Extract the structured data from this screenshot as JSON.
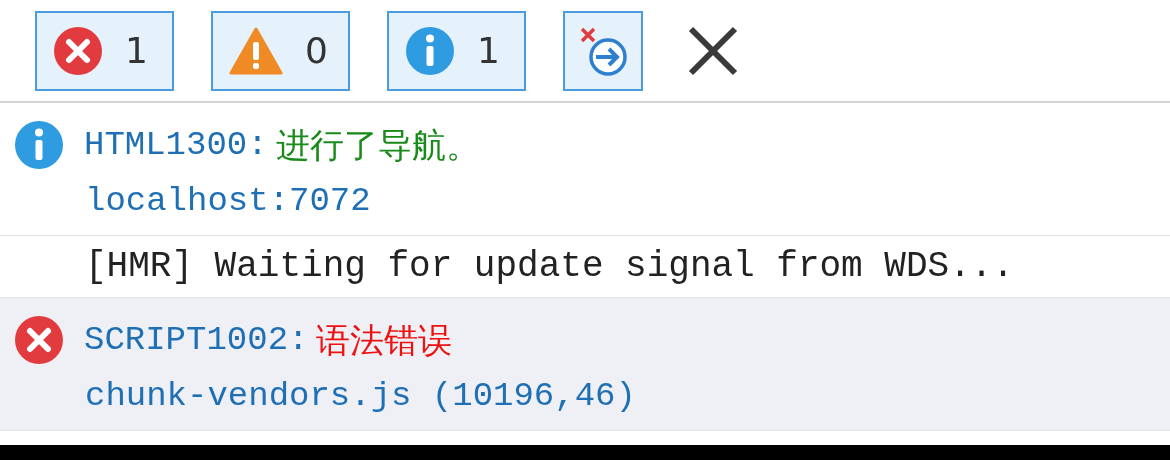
{
  "filters": [
    {
      "kind": "error",
      "count": "1",
      "selected": true
    },
    {
      "kind": "warning",
      "count": "0",
      "selected": true
    },
    {
      "kind": "info",
      "count": "1",
      "selected": true
    }
  ],
  "clear_on_navigate": {
    "on": true
  },
  "messages": [
    {
      "kind": "info",
      "code": "HTML1300:",
      "text": "进行了导航。",
      "source": "localhost:7072",
      "selected": false
    },
    {
      "kind": "log",
      "text": "[HMR] Waiting for update signal from WDS...",
      "selected": false
    },
    {
      "kind": "error",
      "code": "SCRIPT1002:",
      "text": "语法错误",
      "source": "chunk-vendors.js (10196,46)",
      "selected": true
    }
  ]
}
